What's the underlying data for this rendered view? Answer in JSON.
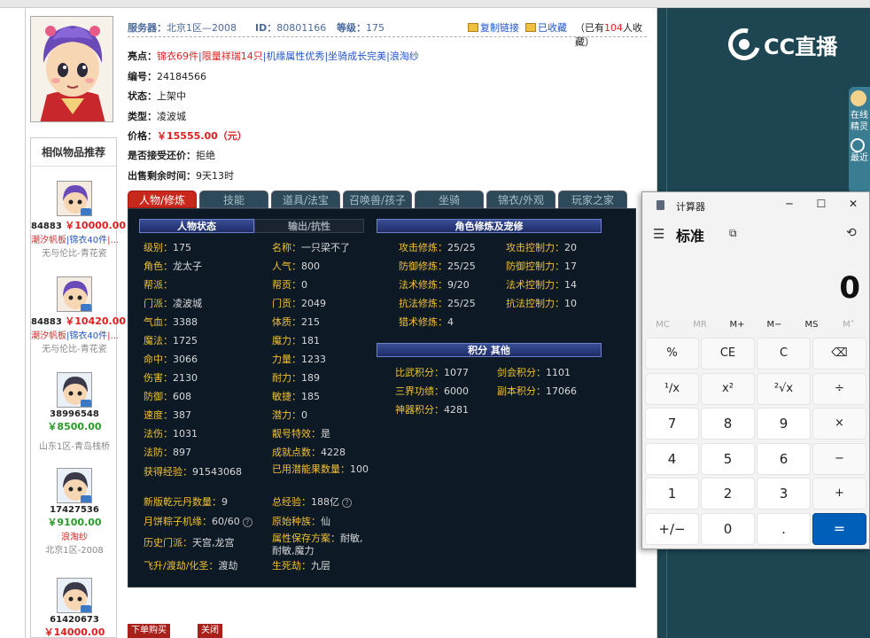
{
  "header": {
    "server_label": "服务器：",
    "server_value": "北京1区—2008",
    "id_label": "ID：",
    "id_value": "80801166",
    "level_label": "等级：",
    "level_value": "175",
    "copy_link": "复制链接",
    "favorited": "已收藏",
    "fav_count_prefix": "（已有",
    "fav_count": "104",
    "fav_count_suffix": "人收藏）"
  },
  "info": {
    "highlights_label": "亮点：",
    "highlights": [
      "锦衣69件",
      "限量祥瑞14只",
      "机缘属性优秀",
      "坐骑成长完美",
      "浪淘纱"
    ],
    "sep": "|",
    "code_label": "编号：",
    "code_value": "24184566",
    "status_label": "状态：",
    "status_value": "上架中",
    "type_label": "类型：",
    "type_value": "凌波城",
    "price_label": "价格：",
    "price_value": "￥15555.00（元）",
    "bargain_label": "是否接受还价：",
    "bargain_value": "拒绝",
    "remain_label": "出售剩余时间：",
    "remain_value": "9天13时"
  },
  "tabs": [
    "人物/修炼",
    "技能",
    "道具/法宝",
    "召唤兽/孩子",
    "坐骑",
    "锦衣/外观",
    "玩家之家"
  ],
  "panel": {
    "hd_char": "人物状态",
    "hd_out": "输出/抗性",
    "hd_cultivation": "角色修炼及宠修",
    "hd_points": "积分 其他",
    "left_col": [
      {
        "k": "级别：",
        "v": "175"
      },
      {
        "k": "角色：",
        "v": "龙太子"
      },
      {
        "k": "帮派：",
        "v": ""
      },
      {
        "k": "门派：",
        "v": "凌波城"
      },
      {
        "k": "气血：",
        "v": "3388"
      },
      {
        "k": "魔法：",
        "v": "1725"
      },
      {
        "k": "命中：",
        "v": "3066"
      },
      {
        "k": "伤害：",
        "v": "2130"
      },
      {
        "k": "防御：",
        "v": "608"
      },
      {
        "k": "速度：",
        "v": "387"
      },
      {
        "k": "法伤：",
        "v": "1031"
      },
      {
        "k": "法防：",
        "v": "897"
      },
      {
        "k": "获得经验：",
        "v": "91543068"
      },
      {
        "k": "新版乾元丹数量：",
        "v": "9"
      },
      {
        "k": "月饼粽子机缘：",
        "v": "60/60"
      },
      {
        "k": "历史门派：",
        "v": "天宫,龙宫"
      },
      {
        "k": "飞升/渡劫/化圣：",
        "v": "渡劫"
      }
    ],
    "mid_col": [
      {
        "k": "名称：",
        "v": "一只梁不了"
      },
      {
        "k": "人气：",
        "v": "800"
      },
      {
        "k": "帮贡：",
        "v": "0"
      },
      {
        "k": "门贡：",
        "v": "2049"
      },
      {
        "k": "体质：",
        "v": "215"
      },
      {
        "k": "魔力：",
        "v": "181"
      },
      {
        "k": "力量：",
        "v": "1233"
      },
      {
        "k": "耐力：",
        "v": "189"
      },
      {
        "k": "敏捷：",
        "v": "185"
      },
      {
        "k": "潜力：",
        "v": "0"
      },
      {
        "k": "靓号特效：",
        "v": "是"
      },
      {
        "k": "成就点数：",
        "v": "4228"
      },
      {
        "k": "已用潜能果数量：",
        "v": "100"
      },
      {
        "k": "总经验：",
        "v": "188亿"
      },
      {
        "k": "原始种族：",
        "v": "仙"
      },
      {
        "k": "属性保存方案：",
        "v": "耐敏,耐敏,魔力"
      },
      {
        "k": "生死劫：",
        "v": "九层"
      }
    ],
    "cult_left": [
      {
        "k": "攻击修炼：",
        "v": "25/25"
      },
      {
        "k": "防御修炼：",
        "v": "25/25"
      },
      {
        "k": "法术修炼：",
        "v": "9/20"
      },
      {
        "k": "抗法修炼：",
        "v": "25/25"
      },
      {
        "k": "猎术修炼：",
        "v": "4"
      }
    ],
    "cult_right": [
      {
        "k": "攻击控制力：",
        "v": "20"
      },
      {
        "k": "防御控制力：",
        "v": "17"
      },
      {
        "k": "法术控制力：",
        "v": "14"
      },
      {
        "k": "抗法控制力：",
        "v": "10"
      }
    ],
    "points_left": [
      {
        "k": "比武积分：",
        "v": "1077"
      },
      {
        "k": "三界功绩：",
        "v": "6000"
      },
      {
        "k": "神器积分：",
        "v": "4281"
      }
    ],
    "points_right": [
      {
        "k": "剑会积分：",
        "v": "1101"
      },
      {
        "k": "副本积分：",
        "v": "17066"
      }
    ],
    "help_glyph": "?"
  },
  "similar": {
    "title": "相似物品推荐",
    "items": [
      {
        "id": "84883",
        "price": "￥10000.00",
        "tag1": "潮汐帆板",
        "tag2": "锦衣40件",
        "tag_more": "|…",
        "server": "无与伦比-青花瓷",
        "style": "red"
      },
      {
        "id": "84883",
        "price": "￥10420.00",
        "tag1": "潮汐帆板",
        "tag2": "锦衣40件",
        "tag_more": "|…",
        "server": "无与伦比-青花瓷",
        "style": "red"
      },
      {
        "id": "38996548",
        "price": "￥8500.00",
        "tag1": "",
        "tag2": "",
        "tag_more": "",
        "server": "山东1区-青岛栈桥",
        "style": "green"
      },
      {
        "id": "17427536",
        "price": "￥9100.00",
        "tag1": "",
        "tag2": "浪淘纱",
        "tag_more": "",
        "server": "北京1区-2008",
        "style": "green"
      },
      {
        "id": "61420673",
        "price": "￥14000.00",
        "tag1": "",
        "tag2": "",
        "tag_more": "",
        "server": "",
        "style": "red"
      }
    ],
    "badge": "售"
  },
  "buttons": {
    "buy": "下单购买",
    "close": "关闭"
  },
  "stream": {
    "brand": "CC直播",
    "side_text1": "在线",
    "side_text2": "精灵",
    "side_text3": "最近"
  },
  "calculator": {
    "title": "计算器",
    "mode": "标准",
    "display": "0",
    "memory": [
      "MC",
      "MR",
      "M+",
      "M−",
      "MS",
      "M˅"
    ],
    "keys": [
      [
        "%",
        "CE",
        "C",
        "⌫"
      ],
      [
        "¹∕x",
        "x²",
        "²√x",
        "÷"
      ],
      [
        "7",
        "8",
        "9",
        "×"
      ],
      [
        "4",
        "5",
        "6",
        "−"
      ],
      [
        "1",
        "2",
        "3",
        "+"
      ],
      [
        "+/−",
        "0",
        ".",
        "="
      ]
    ]
  }
}
